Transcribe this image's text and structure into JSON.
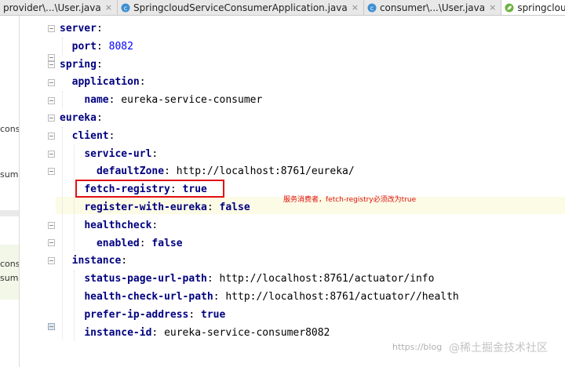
{
  "tabs": [
    {
      "label": "provider\\...\\User.java",
      "active": false
    },
    {
      "label": "SpringcloudServiceConsumerApplication.java",
      "active": false
    },
    {
      "label": "consumer\\...\\User.java",
      "active": false
    },
    {
      "label": "springcloud-service",
      "active": true
    }
  ],
  "close_glyph": "×",
  "left_panel": [
    "cons",
    "sum",
    "cons",
    "sum"
  ],
  "code": {
    "server": "server",
    "port": "port",
    "port_value": "8082",
    "spring": "spring",
    "application": "application",
    "name": "name",
    "name_value": "eureka-service-consumer",
    "eureka": "eureka",
    "client": "client",
    "service_url": "service-url",
    "default_zone": "defaultZone",
    "default_zone_value": "http://localhost:8761/eureka/",
    "fetch_registry": "fetch-registry",
    "fetch_registry_value": "true",
    "register_with_eureka": "register-with-eureka",
    "register_with_eureka_value": "false",
    "healthcheck": "healthcheck",
    "enabled": "enabled",
    "enabled_value": "false",
    "instance": "instance",
    "status_page_url_path": "status-page-url-path",
    "status_page_url_path_value": "http://localhost:8761/actuator/info",
    "health_check_url_path": "health-check-url-path",
    "health_check_url_path_value": "http://localhost:8761/actuator//health",
    "prefer_ip_address": "prefer-ip-address",
    "prefer_ip_address_value": "true",
    "instance_id": "instance-id",
    "instance_id_value": "eureka-service-consumer8082"
  },
  "annotation": "服务消费者，fetch-registry必须改为true",
  "watermark_url": "https://blog",
  "watermark_brand": "@稀土掘金技术社区",
  "colors": {
    "key": "#000080",
    "number": "#0000ff",
    "annotation": "#e01010",
    "highlight": "#fcfbe6"
  }
}
